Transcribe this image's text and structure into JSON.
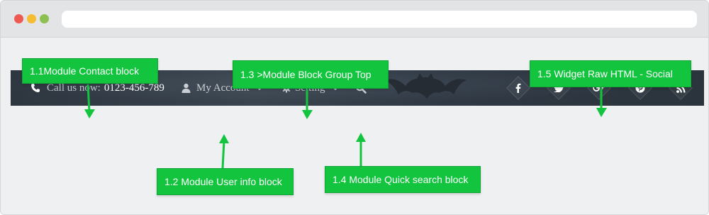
{
  "topbar": {
    "contact_label": "Call us now:",
    "contact_number": "0123-456-789",
    "account_label": "My Account",
    "setting_label": "Setting",
    "social": [
      "facebook-icon",
      "twitter-icon",
      "google-plus-icon",
      "pinterest-icon",
      "rss-icon"
    ]
  },
  "callouts": {
    "contact": "1.1Module Contact block",
    "user_info": "1.2 Module User info block",
    "block_group_top": "1.3 >Module Block Group Top",
    "quick_search": "1.4 Module Quick search block",
    "widget_social": "1.5 Widget Raw HTML - Social"
  },
  "colors": {
    "callout_green": "#13c43f",
    "topbar_dark": "#2e3640",
    "window_red": "#ee5a52",
    "window_yellow": "#f5bd2f",
    "window_green": "#8cc152"
  }
}
